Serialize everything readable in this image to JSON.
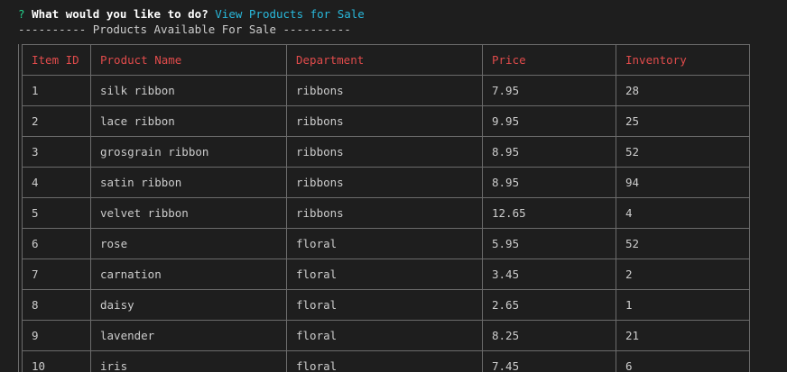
{
  "prompt": {
    "mark": "?",
    "question": "What would you like to do?",
    "answer": "View Products for Sale"
  },
  "banner": "---------- Products Available For Sale ----------",
  "table": {
    "headers": [
      "Item ID",
      "Product Name",
      "Department",
      "Price",
      "Inventory"
    ],
    "rows": [
      [
        "1",
        "silk ribbon",
        "ribbons",
        "7.95",
        "28"
      ],
      [
        "2",
        "lace ribbon",
        "ribbons",
        "9.95",
        "25"
      ],
      [
        "3",
        "grosgrain ribbon",
        "ribbons",
        "8.95",
        "52"
      ],
      [
        "4",
        "satin ribbon",
        "ribbons",
        "8.95",
        "94"
      ],
      [
        "5",
        "velvet ribbon",
        "ribbons",
        "12.65",
        "4"
      ],
      [
        "6",
        "rose",
        "floral",
        "5.95",
        "52"
      ],
      [
        "7",
        "carnation",
        "floral",
        "3.45",
        "2"
      ],
      [
        "8",
        "daisy",
        "floral",
        "2.65",
        "1"
      ],
      [
        "9",
        "lavender",
        "floral",
        "8.25",
        "21"
      ],
      [
        "10",
        "iris",
        "floral",
        "7.45",
        "6"
      ]
    ]
  },
  "colors": {
    "background": "#1e1e1e",
    "prompt_mark": "#23d18b",
    "answer": "#29b8db",
    "header_text": "#e04b4b",
    "border": "#6b6b6b"
  }
}
